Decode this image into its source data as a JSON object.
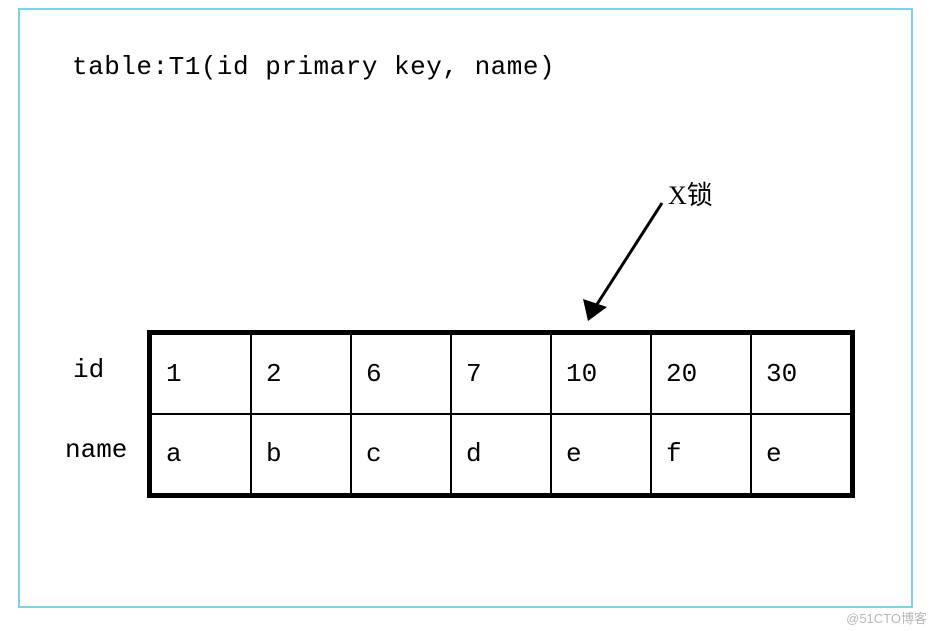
{
  "title": "table:T1(id primary key, name)",
  "lockLabel": "X锁",
  "rowLabels": {
    "id": "id",
    "name": "name"
  },
  "tableData": {
    "idRow": [
      "1",
      "2",
      "6",
      "7",
      "10",
      "20",
      "30"
    ],
    "nameRow": [
      "a",
      "b",
      "c",
      "d",
      "e",
      "f",
      "e"
    ]
  },
  "watermark": "@51CTO博客"
}
